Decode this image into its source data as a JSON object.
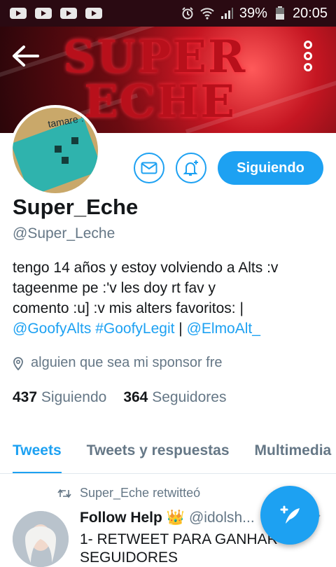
{
  "status_bar": {
    "battery_percent": "39%",
    "time": "20:05",
    "notification_icons": [
      "youtube-icon",
      "youtube-icon",
      "youtube-icon",
      "youtube-icon"
    ]
  },
  "header": {
    "banner_text_line1": "SUPER",
    "banner_text_line2": "ECHE",
    "back_icon": "arrow-left-icon",
    "more_icon": "more-vertical-icon"
  },
  "profile": {
    "avatar_text": "tamare :'v",
    "name": "Super_Eche",
    "handle": "@Super_Leche",
    "bio_line1": "tengo 14 años y estoy volviendo a Alts :v",
    "bio_line2": "tageenme pe :'v les doy rt fav y",
    "bio_line3": "comento :u]  :v mis alters favoritos: |",
    "bio_link1": "@GoofyAlts",
    "bio_link2": "#GoofyLegit",
    "bio_sep": " | ",
    "bio_link3": "@ElmoAlt_",
    "location": "alguien que sea mi sponsor fre",
    "following_count": "437",
    "following_label": "Siguiendo",
    "followers_count": "364",
    "followers_label": "Seguidores",
    "follow_button": "Siguiendo"
  },
  "tabs": [
    {
      "label": "Tweets"
    },
    {
      "label": "Tweets y respuestas"
    },
    {
      "label": "Multimedia"
    }
  ],
  "tweet": {
    "retweet_label": "Super_Eche retwitteó",
    "author_name": "Follow Help",
    "author_emoji": "👑",
    "author_handle": "@idolsh...",
    "text_line1": "1- RETWEET PARA GANHAR",
    "text_line2": "SEGUIDORES"
  },
  "colors": {
    "accent": "#1da1f2",
    "status_bar": "#2a0a12",
    "text_secondary": "#657786"
  }
}
